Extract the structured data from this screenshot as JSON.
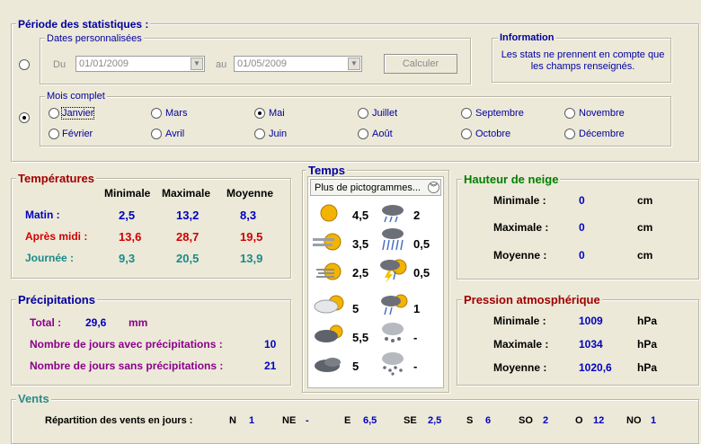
{
  "periode": {
    "title": "Période des statistiques :",
    "dates_group": "Dates personnalisées",
    "du_label": "Du",
    "du_value": "01/01/2009",
    "au_label": "au",
    "au_value": "01/05/2009",
    "calc_button": "Calculer",
    "info_title": "Information",
    "info_text1": "Les stats ne prennent en compte que",
    "info_text2": "les champs renseignés.",
    "mois_group": "Mois complet",
    "months": [
      "Janvier",
      "Février",
      "Mars",
      "Avril",
      "Mai",
      "Juin",
      "Juillet",
      "Août",
      "Septembre",
      "Octobre",
      "Novembre",
      "Décembre"
    ],
    "selected_month": "Mai",
    "selected_mode": "mois"
  },
  "temperatures": {
    "title": "Températures",
    "headers": [
      "Minimale",
      "Maximale",
      "Moyenne"
    ],
    "rows": [
      {
        "label": "Matin :",
        "min": "2,5",
        "max": "13,2",
        "moy": "8,3"
      },
      {
        "label": "Après midi :",
        "min": "13,6",
        "max": "28,7",
        "moy": "19,5"
      },
      {
        "label": "Journée :",
        "min": "9,3",
        "max": "20,5",
        "moy": "13,9"
      }
    ]
  },
  "temps": {
    "title": "Temps",
    "dropdown": "Plus de pictogrammes...",
    "rows": [
      {
        "left_icon": "sun-icon",
        "left_val": "4,5",
        "right_icon": "rain-cloud-icon",
        "right_val": "2"
      },
      {
        "left_icon": "sun-haze-icon",
        "left_val": "3,5",
        "right_icon": "heavy-rain-icon",
        "right_val": "0,5"
      },
      {
        "left_icon": "sun-fog-icon",
        "left_val": "2,5",
        "right_icon": "thunderstorm-icon",
        "right_val": "0,5"
      },
      {
        "left_icon": "partly-cloudy-icon",
        "left_val": "5",
        "right_icon": "sun-rain-icon",
        "right_val": "1"
      },
      {
        "left_icon": "cloudy-icon",
        "left_val": "5,5",
        "right_icon": "snow-cloud-icon",
        "right_val": "-"
      },
      {
        "left_icon": "overcast-icon",
        "left_val": "5",
        "right_icon": "heavy-snow-icon",
        "right_val": "-"
      }
    ]
  },
  "neige": {
    "title": "Hauteur de neige",
    "rows": [
      {
        "label": "Minimale :",
        "value": "0",
        "unit": "cm"
      },
      {
        "label": "Maximale :",
        "value": "0",
        "unit": "cm"
      },
      {
        "label": "Moyenne :",
        "value": "0",
        "unit": "cm"
      }
    ]
  },
  "precip": {
    "title": "Précipitations",
    "total_label": "Total :",
    "total_value": "29,6",
    "total_unit": "mm",
    "avec_label": "Nombre de jours avec précipitations :",
    "avec_value": "10",
    "sans_label": "Nombre de jours sans précipitations :",
    "sans_value": "21"
  },
  "pression": {
    "title": "Pression atmosphérique",
    "rows": [
      {
        "label": "Minimale :",
        "value": "1009",
        "unit": "hPa"
      },
      {
        "label": "Maximale :",
        "value": "1034",
        "unit": "hPa"
      },
      {
        "label": "Moyenne :",
        "value": "1020,6",
        "unit": "hPa"
      }
    ]
  },
  "vents": {
    "title": "Vents",
    "label": "Répartition des vents en jours :",
    "dirs": [
      {
        "dir": "N",
        "val": "1"
      },
      {
        "dir": "NE",
        "val": "-"
      },
      {
        "dir": "E",
        "val": "6,5"
      },
      {
        "dir": "SE",
        "val": "2,5"
      },
      {
        "dir": "S",
        "val": "6"
      },
      {
        "dir": "SO",
        "val": "2"
      },
      {
        "dir": "O",
        "val": "12"
      },
      {
        "dir": "NO",
        "val": "1"
      }
    ]
  }
}
